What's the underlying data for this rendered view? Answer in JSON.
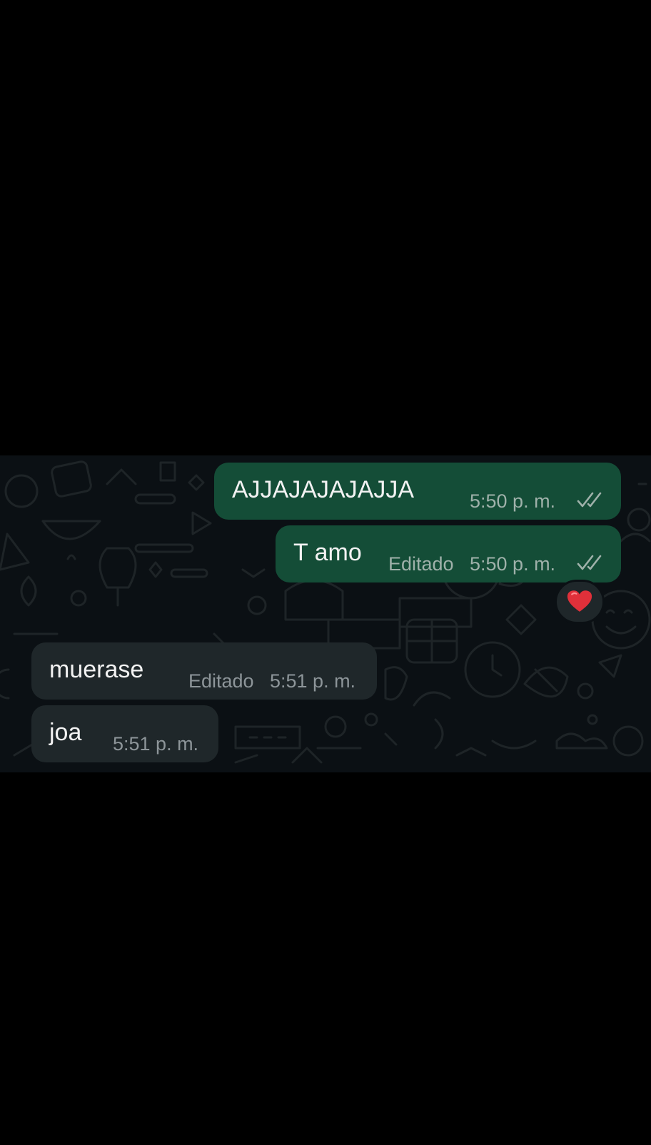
{
  "colors": {
    "background": "#000000",
    "chat_wallpaper": "#0b1014",
    "outgoing_bubble": "#144d37",
    "incoming_bubble": "#1f272a",
    "reaction_heart": "#e0303a"
  },
  "messages": [
    {
      "direction": "outgoing",
      "text": "AJJAJAJAJAJJA",
      "time": "5:50 p. m.",
      "status_icon": "double-check-icon"
    },
    {
      "direction": "outgoing",
      "text": "T amo",
      "edited_label": "Editado",
      "time": "5:50 p. m.",
      "status_icon": "double-check-icon",
      "reaction_icon": "red-heart-icon"
    },
    {
      "direction": "incoming",
      "text": "muerase",
      "edited_label": "Editado",
      "time": "5:51 p. m."
    },
    {
      "direction": "incoming",
      "text": "joa",
      "time": "5:51 p. m."
    }
  ]
}
